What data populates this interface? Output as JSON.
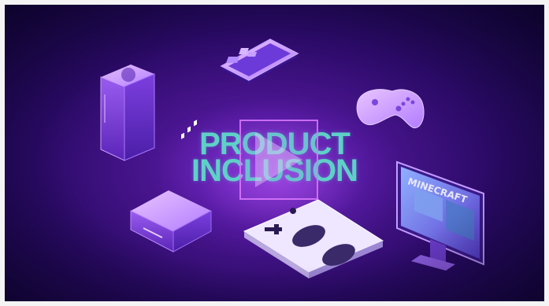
{
  "video": {
    "title_line1": "PRODUCT",
    "title_line2": "INCLUSION",
    "monitor_game_logo": "MINECRAFT",
    "colors": {
      "background_dark": "#150640",
      "background_mid": "#4a1590",
      "title_teal": "#5fd0c8",
      "device_purple": "#b48cff",
      "play_border": "#dc78ff"
    },
    "icons": [
      "play-icon"
    ]
  }
}
